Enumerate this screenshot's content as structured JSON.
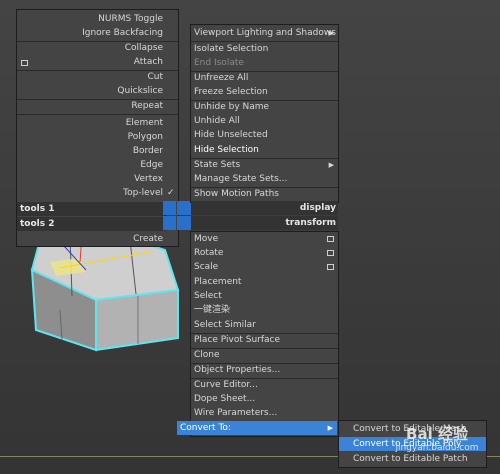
{
  "quad_left": {
    "items": [
      {
        "label": "NURMS Toggle"
      },
      {
        "label": "Ignore Backfacing"
      },
      {
        "label": "Collapse"
      },
      {
        "label": "Attach"
      },
      {
        "label": "Cut"
      },
      {
        "label": "Quickslice"
      },
      {
        "label": "Repeat"
      },
      {
        "label": "Element"
      },
      {
        "label": "Polygon"
      },
      {
        "label": "Border"
      },
      {
        "label": "Edge"
      },
      {
        "label": "Vertex"
      },
      {
        "label": "Top-level",
        "check": "✓"
      }
    ],
    "tools1": "tools 1",
    "tools2": "tools 2",
    "create": "Create"
  },
  "quad_right": {
    "items": [
      {
        "label": "Viewport Lighting and Shadows"
      },
      {
        "label": "Isolate Selection"
      },
      {
        "label": "End Isolate"
      },
      {
        "label": "Unfreeze All"
      },
      {
        "label": "Freeze Selection"
      },
      {
        "label": "Unhide by Name"
      },
      {
        "label": "Unhide All"
      },
      {
        "label": "Hide Unselected"
      },
      {
        "label": "Hide Selection"
      },
      {
        "label": "State Sets"
      },
      {
        "label": "Manage State Sets..."
      },
      {
        "label": "Show Motion Paths"
      }
    ],
    "display": "display",
    "transform": "transform",
    "lower_items": [
      {
        "label": "Move"
      },
      {
        "label": "Rotate"
      },
      {
        "label": "Scale"
      },
      {
        "label": "Placement"
      },
      {
        "label": "Select"
      },
      {
        "label": "一键渲染"
      },
      {
        "label": "Select Similar"
      },
      {
        "label": "Place Pivot Surface"
      },
      {
        "label": "Clone"
      },
      {
        "label": "Object Properties..."
      },
      {
        "label": "Curve Editor..."
      },
      {
        "label": "Dope Sheet..."
      },
      {
        "label": "Wire Parameters..."
      },
      {
        "label": "Convert To:"
      }
    ]
  },
  "submenu": {
    "items": [
      {
        "label": "Convert to Editable Mesh"
      },
      {
        "label": "Convert to Editable Poly"
      },
      {
        "label": "Convert to Editable Patch"
      }
    ]
  },
  "watermark": {
    "line1": "Bai 经验",
    "line2": "jingyan.baidu.com"
  },
  "colors": {
    "highlight": "#3a83d6",
    "menu_bg": "#444444",
    "selection_edge": "#5ee6f0"
  }
}
